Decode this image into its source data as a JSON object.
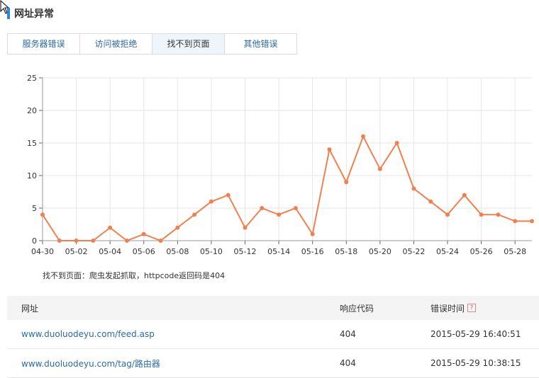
{
  "section": {
    "title": "网址异常"
  },
  "tabs": [
    {
      "label": "服务器错误"
    },
    {
      "label": "访问被拒绝"
    },
    {
      "label": "找不到页面"
    },
    {
      "label": "其他错误"
    }
  ],
  "active_tab": 2,
  "chart_data": {
    "type": "line",
    "x": [
      "04-30",
      "05-01",
      "05-02",
      "05-03",
      "05-04",
      "05-05",
      "05-06",
      "05-07",
      "05-08",
      "05-09",
      "05-10",
      "05-11",
      "05-12",
      "05-13",
      "05-14",
      "05-15",
      "05-16",
      "05-17",
      "05-18",
      "05-19",
      "05-20",
      "05-21",
      "05-22",
      "05-23",
      "05-24",
      "05-25",
      "05-26",
      "05-27",
      "05-28",
      "05-29"
    ],
    "values": [
      4,
      0,
      0,
      0,
      2,
      0,
      1,
      0,
      2,
      4,
      6,
      7,
      2,
      5,
      4,
      5,
      1,
      14,
      9,
      16,
      11,
      15,
      8,
      6,
      4,
      7,
      4,
      4,
      3,
      3
    ],
    "xticks": [
      "04-30",
      "05-02",
      "05-04",
      "05-06",
      "05-08",
      "05-10",
      "05-12",
      "05-14",
      "05-16",
      "05-18",
      "05-20",
      "05-22",
      "05-24",
      "05-26",
      "05-28"
    ],
    "yticks": [
      0,
      5,
      10,
      15,
      20,
      25
    ],
    "ylim": [
      0,
      25
    ],
    "grid": true,
    "color": "#f08050"
  },
  "caption": "找不到页面：爬虫发起抓取，httpcode返回码是404",
  "table": {
    "headers": {
      "url": "网址",
      "code": "响应代码",
      "time": "错误时间",
      "help_icon": "?"
    },
    "rows": [
      {
        "url": "www.duoluodeyu.com/feed.asp",
        "code": "404",
        "time": "2015-05-29 16:40:51"
      },
      {
        "url": "www.duoluodeyu.com/tag/路由器",
        "code": "404",
        "time": "2015-05-29 10:38:15"
      }
    ]
  }
}
